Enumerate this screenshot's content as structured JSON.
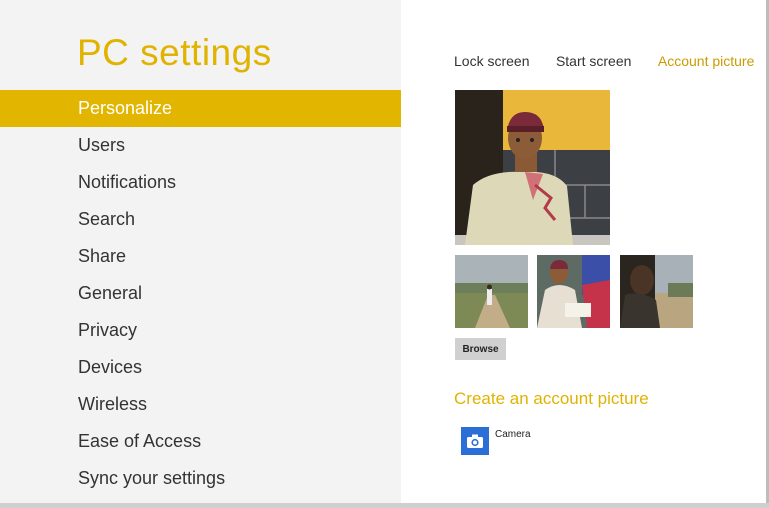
{
  "app": {
    "title": "PC settings"
  },
  "nav": {
    "items": [
      {
        "label": "Personalize",
        "active": true
      },
      {
        "label": "Users"
      },
      {
        "label": "Notifications"
      },
      {
        "label": "Search"
      },
      {
        "label": "Share"
      },
      {
        "label": "General"
      },
      {
        "label": "Privacy"
      },
      {
        "label": "Devices"
      },
      {
        "label": "Wireless"
      },
      {
        "label": "Ease of Access"
      },
      {
        "label": "Sync your settings"
      }
    ]
  },
  "tabs": {
    "lock_screen": "Lock screen",
    "start_screen": "Start screen",
    "account_picture": "Account picture",
    "active": "Account picture"
  },
  "account": {
    "browse_label": "Browse",
    "create_title": "Create an account picture",
    "camera_label": "Camera",
    "camera_icon": "camera-icon"
  },
  "colors": {
    "accent": "#e1b500",
    "accent_text": "#c99b00",
    "camera_tile": "#2b6fd6",
    "left_panel": "#f3f3f3"
  }
}
